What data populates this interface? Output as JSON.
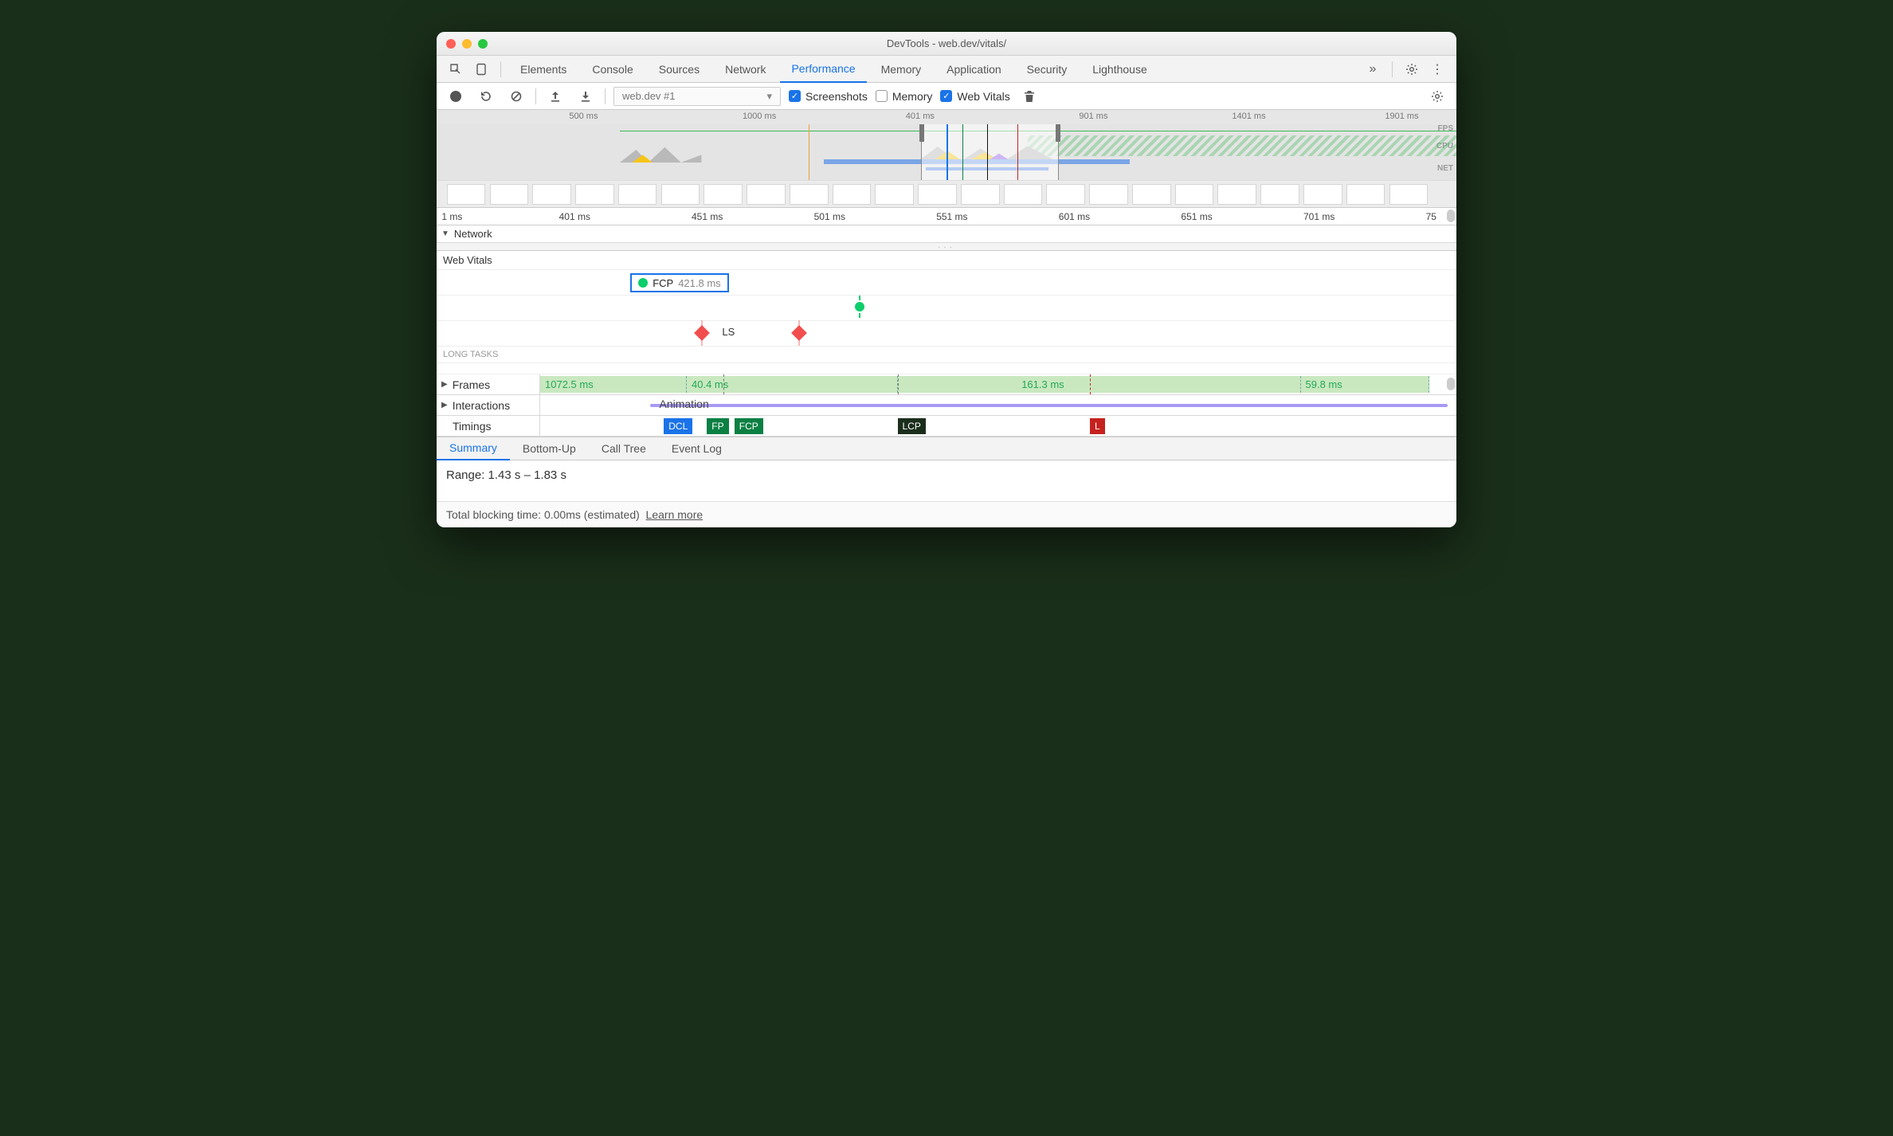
{
  "window": {
    "title": "DevTools - web.dev/vitals/"
  },
  "tabs": {
    "items": [
      "Elements",
      "Console",
      "Sources",
      "Network",
      "Performance",
      "Memory",
      "Application",
      "Security",
      "Lighthouse"
    ],
    "active": "Performance"
  },
  "toolbar": {
    "recording_select": "web.dev #1",
    "screenshots_label": "Screenshots",
    "memory_label": "Memory",
    "webvitals_label": "Web Vitals",
    "screenshots_checked": true,
    "memory_checked": false,
    "webvitals_checked": true
  },
  "overview": {
    "ticks": [
      "500 ms",
      "1000 ms",
      "401 ms",
      "901 ms",
      "1401 ms",
      "1901 ms"
    ],
    "lane_labels": [
      "FPS",
      "CPU",
      "NET"
    ]
  },
  "detail_ruler": [
    "1 ms",
    "401 ms",
    "451 ms",
    "501 ms",
    "551 ms",
    "601 ms",
    "651 ms",
    "701 ms",
    "75"
  ],
  "network_section": {
    "label": "Network"
  },
  "web_vitals": {
    "section_label": "Web Vitals",
    "fcp": {
      "name": "FCP",
      "value": "421.8 ms"
    },
    "ls_label": "LS",
    "long_tasks_label": "LONG TASKS"
  },
  "frames": {
    "label": "Frames",
    "segments": [
      "1072.5 ms",
      "40.4 ms",
      "161.3 ms",
      "59.8 ms"
    ]
  },
  "interactions": {
    "label": "Interactions",
    "animation_label": "Animation"
  },
  "timings": {
    "label": "Timings",
    "tags": {
      "dcl": "DCL",
      "fp": "FP",
      "fcp": "FCP",
      "lcp": "LCP",
      "l": "L"
    }
  },
  "bottom_tabs": {
    "items": [
      "Summary",
      "Bottom-Up",
      "Call Tree",
      "Event Log"
    ],
    "active": "Summary"
  },
  "summary": {
    "range": "Range: 1.43 s – 1.83 s"
  },
  "footer": {
    "tbt": "Total blocking time: 0.00ms (estimated)",
    "learn_more": "Learn more"
  }
}
